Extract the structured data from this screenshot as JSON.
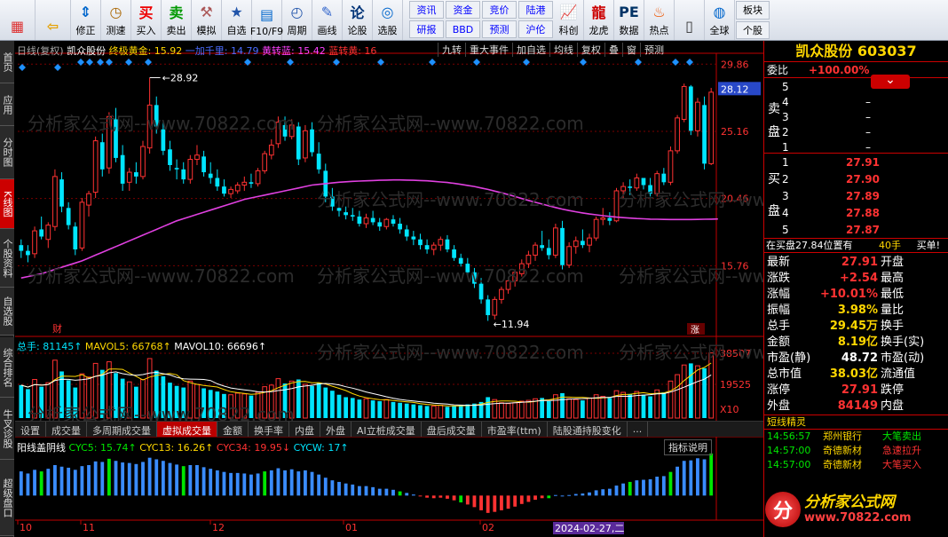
{
  "toolbar": {
    "buttons": [
      {
        "label": "",
        "icon": "grid-icon"
      },
      {
        "label": "",
        "icon": "back-arrow-icon"
      },
      {
        "label": "修正",
        "icon": "up-down-icon"
      },
      {
        "label": "测速",
        "icon": "clock-icon"
      },
      {
        "label": "买入",
        "icon": "buy-icon"
      },
      {
        "label": "卖出",
        "icon": "sell-icon"
      },
      {
        "label": "模拟",
        "icon": "hammer-icon"
      },
      {
        "label": "自选",
        "icon": "star-folder-icon"
      },
      {
        "label": "F10/F9",
        "icon": "window-icon"
      },
      {
        "label": "周期",
        "icon": "cycle-icon"
      },
      {
        "label": "画线",
        "icon": "pencil-icon"
      },
      {
        "label": "论股",
        "icon": "discuss-icon"
      },
      {
        "label": "选股",
        "icon": "select-stock-icon"
      }
    ],
    "grid": [
      "资讯",
      "资金",
      "竞价",
      "陆港",
      "研报",
      "BBD",
      "预测",
      "沪伦"
    ],
    "buttons2": [
      {
        "label": "科创",
        "icon": "chart-icon"
      },
      {
        "label": "龙虎",
        "icon": "dragon-icon"
      },
      {
        "label": "数据",
        "icon": "pe-icon"
      },
      {
        "label": "热点",
        "icon": "fire-icon"
      },
      {
        "label": "",
        "icon": "phone-icon"
      },
      {
        "label": "全球",
        "icon": "globe-icon"
      }
    ],
    "stack": [
      "板块",
      "个股"
    ]
  },
  "left_tabs": [
    "首页",
    "应用",
    "分时图",
    "K线图",
    "个股资料",
    "自选股",
    "综合排名",
    "牛叉诊股",
    "超级盘口"
  ],
  "chart_header": {
    "line1_prefix": "日线(复权)",
    "stock": "凯众股份",
    "items": [
      {
        "text": "终极黄金: 15.92",
        "color": "#ffd700"
      },
      {
        "text": "一加千里: 14.79",
        "color": "#4a6cff"
      },
      {
        "text": "黄转蓝: 15.42",
        "color": "#ff40ff"
      },
      {
        "text": "蓝转黄: 16",
        "color": "#ff3232"
      }
    ],
    "menu": [
      "九转",
      "重大事件",
      "加自选",
      "均线",
      "复权",
      "叠",
      "窗",
      "预测"
    ]
  },
  "price_axis": [
    "29.86",
    "25.16",
    "20.46",
    "15.76"
  ],
  "current_price_tag": "28.12",
  "annotations": {
    "high": "28.92",
    "low": "11.94",
    "cai": "财",
    "zhang": "涨"
  },
  "volume_legend": {
    "items": [
      {
        "text": "总手: 81145↑",
        "color": "#00e5ff"
      },
      {
        "text": "MAVOL5: 66768↑",
        "color": "#ffd700"
      },
      {
        "text": "MAVOL10: 66696↑",
        "color": "#ffffff"
      }
    ],
    "axis": [
      "38507",
      "19525",
      "X10"
    ]
  },
  "indicator_tabs": [
    "设置",
    "成交量",
    "多周期成交量",
    "虚拟成交量",
    "金额",
    "换手率",
    "内盘",
    "外盘",
    "AI立桩成交量",
    "盘后成交量",
    "市盈率(ttm)",
    "陆股通持股变化",
    "..."
  ],
  "indicator_active": "虚拟成交量",
  "sub_legend": {
    "name": "阳线盖阴线",
    "items": [
      {
        "text": "CYC5: 15.74↑",
        "color": "#00e600"
      },
      {
        "text": "CYC13: 16.26↑",
        "color": "#ffd700"
      },
      {
        "text": "CYC34: 19.95↓",
        "color": "#ff3232"
      },
      {
        "text": "CYCW: 17↑",
        "color": "#00e5ff"
      }
    ],
    "help": "指标说明"
  },
  "date_axis": [
    "10",
    "11",
    "12",
    "01",
    "02"
  ],
  "date_cursor": "2024-02-27,二",
  "watermark_text": "分析家公式网--www.70822.com",
  "chart_data": {
    "type": "candlestick",
    "price_range": [
      11.0,
      30.5
    ],
    "ma_color": "#e040e0",
    "ohlc": [
      [
        17.2,
        17.6,
        16.3,
        16.8
      ],
      [
        16.8,
        17.2,
        16.0,
        16.5
      ],
      [
        16.6,
        18.5,
        16.3,
        18.2
      ],
      [
        18.3,
        19.2,
        17.6,
        17.8
      ],
      [
        17.6,
        18.8,
        17.0,
        18.6
      ],
      [
        18.5,
        22.5,
        18.2,
        22.0
      ],
      [
        21.8,
        22.3,
        19.5,
        19.9
      ],
      [
        19.8,
        20.2,
        18.3,
        18.6
      ],
      [
        18.5,
        18.8,
        16.5,
        16.9
      ],
      [
        17.0,
        20.5,
        16.8,
        20.2
      ],
      [
        20.0,
        21.0,
        19.2,
        20.8
      ],
      [
        20.9,
        24.8,
        20.5,
        24.5
      ],
      [
        24.4,
        25.0,
        22.0,
        22.5
      ],
      [
        22.6,
        26.5,
        22.2,
        26.2
      ],
      [
        26.0,
        26.8,
        23.0,
        23.3
      ],
      [
        23.5,
        24.2,
        21.0,
        21.5
      ],
      [
        21.6,
        22.6,
        21.0,
        22.3
      ],
      [
        22.3,
        23.0,
        21.5,
        22.0
      ],
      [
        22.0,
        24.5,
        21.8,
        24.1
      ],
      [
        24.0,
        28.9,
        23.6,
        27.0
      ],
      [
        27.0,
        27.6,
        25.0,
        25.5
      ],
      [
        25.3,
        25.8,
        23.5,
        23.8
      ],
      [
        23.9,
        24.5,
        22.4,
        22.8
      ],
      [
        22.6,
        23.2,
        21.8,
        22.5
      ],
      [
        22.5,
        23.0,
        21.5,
        21.8
      ],
      [
        21.8,
        23.5,
        21.5,
        23.2
      ],
      [
        23.2,
        24.2,
        22.8,
        23.5
      ],
      [
        23.4,
        23.8,
        22.0,
        22.3
      ],
      [
        22.2,
        23.0,
        21.5,
        21.9
      ],
      [
        21.9,
        22.5,
        21.0,
        21.3
      ],
      [
        21.3,
        21.8,
        20.6,
        20.8
      ],
      [
        20.8,
        21.3,
        20.5,
        21.1
      ],
      [
        21.0,
        21.6,
        20.8,
        21.4
      ],
      [
        21.4,
        22.0,
        21.0,
        21.6
      ],
      [
        21.6,
        22.2,
        21.2,
        21.5
      ],
      [
        21.5,
        22.6,
        21.3,
        22.4
      ],
      [
        22.4,
        23.8,
        22.2,
        23.6
      ],
      [
        23.5,
        24.6,
        23.2,
        24.2
      ],
      [
        24.3,
        26.2,
        24.0,
        25.8
      ],
      [
        25.6,
        26.2,
        24.5,
        24.8
      ],
      [
        24.8,
        26.0,
        24.6,
        25.6
      ],
      [
        25.5,
        25.8,
        22.8,
        23.2
      ],
      [
        23.3,
        25.6,
        23.0,
        25.2
      ],
      [
        25.3,
        25.8,
        23.4,
        23.7
      ],
      [
        23.6,
        24.4,
        22.2,
        22.5
      ],
      [
        22.4,
        22.9,
        20.2,
        20.6
      ],
      [
        20.6,
        21.2,
        19.6,
        19.9
      ],
      [
        19.8,
        20.3,
        19.2,
        19.6
      ],
      [
        19.5,
        19.9,
        19.0,
        19.3
      ],
      [
        19.3,
        19.8,
        18.9,
        19.2
      ],
      [
        19.2,
        19.6,
        18.5,
        18.7
      ],
      [
        18.7,
        19.4,
        18.4,
        19.1
      ],
      [
        19.1,
        19.6,
        18.6,
        18.8
      ],
      [
        18.8,
        19.1,
        18.2,
        18.5
      ],
      [
        18.5,
        19.1,
        18.3,
        19.0
      ],
      [
        19.0,
        19.3,
        18.5,
        18.7
      ],
      [
        18.7,
        19.1,
        18.0,
        18.3
      ],
      [
        18.3,
        18.6,
        17.5,
        17.8
      ],
      [
        17.8,
        18.2,
        17.2,
        17.6
      ],
      [
        17.6,
        18.0,
        16.9,
        17.2
      ],
      [
        17.2,
        17.6,
        16.6,
        16.9
      ],
      [
        16.9,
        17.4,
        16.5,
        17.2
      ],
      [
        17.2,
        17.8,
        16.8,
        17.6
      ],
      [
        17.6,
        17.9,
        16.7,
        16.9
      ],
      [
        16.9,
        17.2,
        16.1,
        16.3
      ],
      [
        16.3,
        16.6,
        15.7,
        15.9
      ],
      [
        15.9,
        16.3,
        15.1,
        15.3
      ],
      [
        15.3,
        15.6,
        14.2,
        14.5
      ],
      [
        14.5,
        14.9,
        13.1,
        13.4
      ],
      [
        13.4,
        13.7,
        11.9,
        12.3
      ],
      [
        12.3,
        13.6,
        12.0,
        13.4
      ],
      [
        13.4,
        14.3,
        13.1,
        14.1
      ],
      [
        14.1,
        14.9,
        13.8,
        14.7
      ],
      [
        14.7,
        15.5,
        14.3,
        15.3
      ],
      [
        15.2,
        16.2,
        15.0,
        15.9
      ],
      [
        15.9,
        16.8,
        15.6,
        16.5
      ],
      [
        16.5,
        17.4,
        16.1,
        17.2
      ],
      [
        17.2,
        18.2,
        16.8,
        17.0
      ],
      [
        17.0,
        17.6,
        16.2,
        16.5
      ],
      [
        16.5,
        18.7,
        16.3,
        18.4
      ],
      [
        18.4,
        18.9,
        15.5,
        15.8
      ],
      [
        15.8,
        17.4,
        15.6,
        17.1
      ],
      [
        17.1,
        17.8,
        16.6,
        17.5
      ],
      [
        17.5,
        18.3,
        17.0,
        17.2
      ],
      [
        17.2,
        18.0,
        16.7,
        17.7
      ],
      [
        17.7,
        19.2,
        17.5,
        19.0
      ],
      [
        19.0,
        19.8,
        18.6,
        19.1
      ],
      [
        19.1,
        19.5,
        18.6,
        18.9
      ],
      [
        18.9,
        21.2,
        18.8,
        21.0
      ],
      [
        21.0,
        21.6,
        20.5,
        21.3
      ],
      [
        21.3,
        21.8,
        20.7,
        21.2
      ],
      [
        21.2,
        22.2,
        21.0,
        21.9
      ],
      [
        21.9,
        21.6,
        21.1,
        21.4
      ],
      [
        21.4,
        21.9,
        20.6,
        20.8
      ],
      [
        20.8,
        22.4,
        20.6,
        22.2
      ],
      [
        22.2,
        22.6,
        21.4,
        21.6
      ],
      [
        21.6,
        24.1,
        21.4,
        23.8
      ],
      [
        23.8,
        26.3,
        23.6,
        26.1
      ],
      [
        26.0,
        28.5,
        25.8,
        28.3
      ],
      [
        28.3,
        28.4,
        24.9,
        25.2
      ],
      [
        25.2,
        27.5,
        24.8,
        27.2
      ],
      [
        27.0,
        27.6,
        22.5,
        22.9
      ],
      [
        22.9,
        28.2,
        22.8,
        27.9
      ]
    ],
    "ma": [
      14.9,
      15.0,
      15.1,
      15.2,
      15.35,
      15.5,
      15.65,
      15.8,
      15.95,
      16.1,
      16.3,
      16.5,
      16.7,
      16.9,
      17.1,
      17.3,
      17.5,
      17.7,
      17.9,
      18.1,
      18.3,
      18.5,
      18.7,
      18.9,
      19.05,
      19.2,
      19.35,
      19.5,
      19.65,
      19.8,
      19.95,
      20.1,
      20.25,
      20.4,
      20.5,
      20.6,
      20.7,
      20.8,
      20.9,
      21.0,
      21.1,
      21.2,
      21.3,
      21.4,
      21.45,
      21.5,
      21.55,
      21.6,
      21.63,
      21.66,
      21.68,
      21.7,
      21.72,
      21.74,
      21.75,
      21.76,
      21.76,
      21.75,
      21.74,
      21.72,
      21.7,
      21.66,
      21.62,
      21.58,
      21.52,
      21.45,
      21.38,
      21.3,
      21.2,
      21.1,
      20.98,
      20.86,
      20.74,
      20.6,
      20.46,
      20.33,
      20.2,
      20.07,
      19.95,
      19.83,
      19.72,
      19.62,
      19.53,
      19.45,
      19.38,
      19.32,
      19.26,
      19.21,
      19.16,
      19.12,
      19.09,
      19.06,
      19.04,
      19.02,
      19.01,
      19.0,
      18.99,
      18.99,
      18.99,
      18.99,
      19.0,
      19.01,
      19.02,
      19.03
    ],
    "volume": [
      4.1,
      3.6,
      4.8,
      3.9,
      4.4,
      7.2,
      5.8,
      4.7,
      3.8,
      5.5,
      5.1,
      6.8,
      6.0,
      7.0,
      5.6,
      4.9,
      4.5,
      3.9,
      4.8,
      7.4,
      5.9,
      5.2,
      4.4,
      4.0,
      3.8,
      4.6,
      4.2,
      3.7,
      3.5,
      3.3,
      3.0,
      2.9,
      3.1,
      3.0,
      2.8,
      3.2,
      3.9,
      4.1,
      4.9,
      4.3,
      4.6,
      4.8,
      4.2,
      4.0,
      4.4,
      3.8,
      3.4,
      2.9,
      2.6,
      2.5,
      2.3,
      2.4,
      2.2,
      2.1,
      2.3,
      2.0,
      1.9,
      1.8,
      1.7,
      1.6,
      1.5,
      1.5,
      1.6,
      1.4,
      1.5,
      1.6,
      1.7,
      1.8,
      2.0,
      2.6,
      2.3,
      1.9,
      1.8,
      1.9,
      2.1,
      2.2,
      2.4,
      2.5,
      2.1,
      2.9,
      3.1,
      2.4,
      2.3,
      2.2,
      2.5,
      2.9,
      2.7,
      2.5,
      3.4,
      3.2,
      3.0,
      3.3,
      2.9,
      2.7,
      3.5,
      3.2,
      4.6,
      5.4,
      6.6,
      6.8,
      6.5,
      6.2,
      8.1
    ],
    "volume_range": [
      0,
      8.5
    ],
    "indicator": [
      4.6,
      4.2,
      4.9,
      4.6,
      5.1,
      5.8,
      5.5,
      5.3,
      4.9,
      5.6,
      5.8,
      6.5,
      6.4,
      7.0,
      6.6,
      6.3,
      6.2,
      6.0,
      6.4,
      7.2,
      6.9,
      6.6,
      6.2,
      5.9,
      5.6,
      5.8,
      5.8,
      5.4,
      5.1,
      4.8,
      4.5,
      4.3,
      4.3,
      4.2,
      4.0,
      4.2,
      4.6,
      4.8,
      5.2,
      4.8,
      5.0,
      4.6,
      4.8,
      4.5,
      4.0,
      3.4,
      2.9,
      2.6,
      2.3,
      2.1,
      1.8,
      1.8,
      1.6,
      1.3,
      1.3,
      1.1,
      0.8,
      0.5,
      0.2,
      -0.1,
      -0.4,
      -0.5,
      -0.4,
      -0.6,
      -0.9,
      -1.3,
      -1.7,
      -2.2,
      -2.8,
      -3.3,
      -3.1,
      -2.8,
      -2.5,
      -2.1,
      -1.6,
      -1.2,
      -0.8,
      -0.5,
      -0.5,
      0.1,
      0.0,
      0.1,
      0.3,
      0.4,
      0.6,
      1.0,
      1.2,
      1.3,
      1.9,
      2.3,
      2.6,
      2.9,
      3.0,
      3.1,
      3.6,
      3.7,
      4.5,
      5.5,
      6.6,
      6.7,
      7.1,
      6.9,
      8.0
    ],
    "indicator_range": [
      -4,
      8.5
    ],
    "indicator_green": [
      3,
      13,
      24,
      36,
      56,
      65,
      78,
      90,
      96,
      102
    ],
    "high_index": 19,
    "low_index": 69
  },
  "right_panel": {
    "name": "凯众股份",
    "code": "603037",
    "weibi_label": "委比",
    "weibi_value": "+100.00%",
    "sell_label": [
      "卖",
      "盘"
    ],
    "buy_label": [
      "买",
      "盘"
    ],
    "sell": [
      {
        "lvl": "5",
        "price": "",
        "vol": ""
      },
      {
        "lvl": "4",
        "price": "–",
        "vol": ""
      },
      {
        "lvl": "3",
        "price": "–",
        "vol": ""
      },
      {
        "lvl": "2",
        "price": "–",
        "vol": ""
      },
      {
        "lvl": "1",
        "price": "–",
        "vol": ""
      }
    ],
    "buy": [
      {
        "lvl": "1",
        "price": "27.91"
      },
      {
        "lvl": "2",
        "price": "27.90"
      },
      {
        "lvl": "3",
        "price": "27.89"
      },
      {
        "lvl": "4",
        "price": "27.88"
      },
      {
        "lvl": "5",
        "price": "27.87"
      }
    ],
    "position_text": "在买盘27.84位置有",
    "position_hands": "40手",
    "position_action": "买单!",
    "quote": [
      {
        "l1": "最新",
        "v1": "27.91",
        "c1": "red",
        "l2": "开盘"
      },
      {
        "l1": "涨跌",
        "v1": "+2.54",
        "c1": "red",
        "l2": "最高"
      },
      {
        "l1": "涨幅",
        "v1": "+10.01%",
        "c1": "red",
        "l2": "最低"
      },
      {
        "l1": "振幅",
        "v1": "3.98%",
        "c1": "yel",
        "l2": "量比"
      },
      {
        "l1": "总手",
        "v1": "29.45万",
        "c1": "yel",
        "l2": "换手"
      },
      {
        "l1": "金额",
        "v1": "8.19亿",
        "c1": "yel",
        "l2": "换手(实)"
      },
      {
        "l1": "市盈(静)",
        "v1": "48.72",
        "c1": "wht",
        "l2": "市盈(动)"
      },
      {
        "l1": "总市值",
        "v1": "38.03亿",
        "c1": "yel",
        "l2": "流通值"
      },
      {
        "l1": "涨停",
        "v1": "27.91",
        "c1": "red",
        "l2": "跌停"
      },
      {
        "l1": "外盘",
        "v1": "84149",
        "c1": "red",
        "l2": "内盘"
      }
    ],
    "short_title": "短线精灵",
    "short_items": [
      {
        "time": "14:56:57",
        "name": "郑州银行",
        "event": "大笔卖出",
        "ecolor": "grn"
      },
      {
        "time": "14:57:00",
        "name": "奇德新材",
        "event": "急速拉升",
        "ecolor": "red"
      },
      {
        "time": "14:57:00",
        "name": "奇德新材",
        "event": "大笔买入",
        "ecolor": "red"
      }
    ]
  },
  "watermark": {
    "logo": "分",
    "title": "分析家公式网",
    "url": "www.70822.com"
  },
  "colors": {
    "up": "#ff3232",
    "down": "#00e5ff",
    "ma": "#e040e0",
    "grid": "#7a0000",
    "axis": "#c00000"
  }
}
